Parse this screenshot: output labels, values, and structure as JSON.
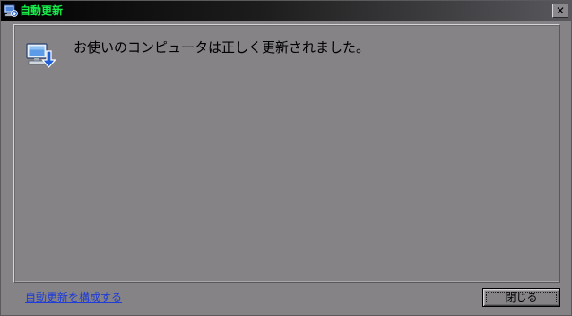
{
  "window": {
    "title": "自動更新",
    "close_glyph": "✕"
  },
  "icons": {
    "title_icon": "windows-update-icon",
    "message_icon": "computer-update-download-icon"
  },
  "content": {
    "message": "お使いのコンピュータは正しく更新されました。"
  },
  "footer": {
    "configure_link": "自動更新を構成する",
    "close_button": "閉じる"
  },
  "colors": {
    "title_text": "#16f04a",
    "link": "#1f3cd8",
    "background": "#858386"
  }
}
